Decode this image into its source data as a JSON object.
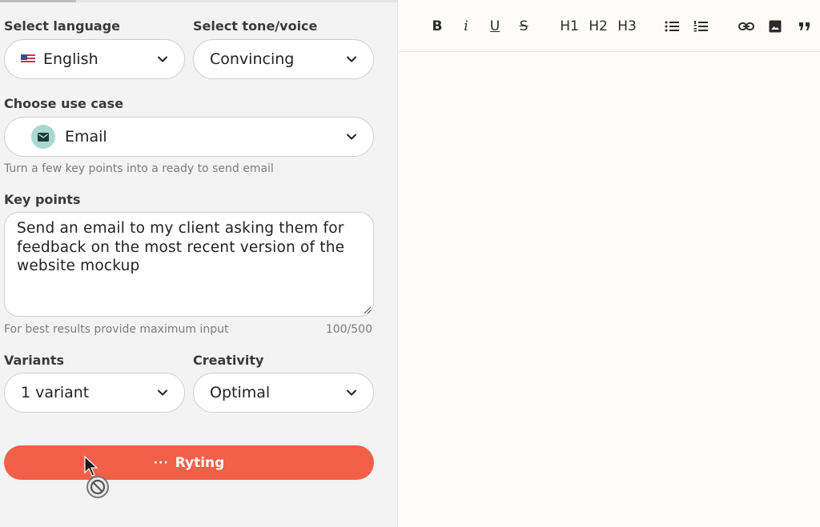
{
  "form": {
    "language": {
      "label": "Select language",
      "value": "English",
      "flag_icon": "us-flag-icon"
    },
    "tone": {
      "label": "Select tone/voice",
      "value": "Convincing"
    },
    "use_case": {
      "label": "Choose use case",
      "value": "Email",
      "icon": "mail-icon",
      "hint": "Turn a few key points into a ready to send email"
    },
    "key_points": {
      "label": "Key points",
      "value": "Send an email to my client asking them for feedback on the most recent version of the website mockup",
      "hint": "For best results provide maximum input",
      "counter": "100/500"
    },
    "variants": {
      "label": "Variants",
      "value": "1 variant"
    },
    "creativity": {
      "label": "Creativity",
      "value": "Optimal"
    },
    "submit": {
      "label": "Ryting",
      "dots": "···"
    }
  },
  "toolbar": {
    "bold": "B",
    "italic": "i",
    "underline": "U",
    "strike": "S",
    "h1": "H1",
    "h2": "H2",
    "h3": "H3"
  },
  "colors": {
    "accent": "#f2604a",
    "panel_bg": "#f3f3f3",
    "usecase_icon_bg": "#a8d8cf"
  }
}
